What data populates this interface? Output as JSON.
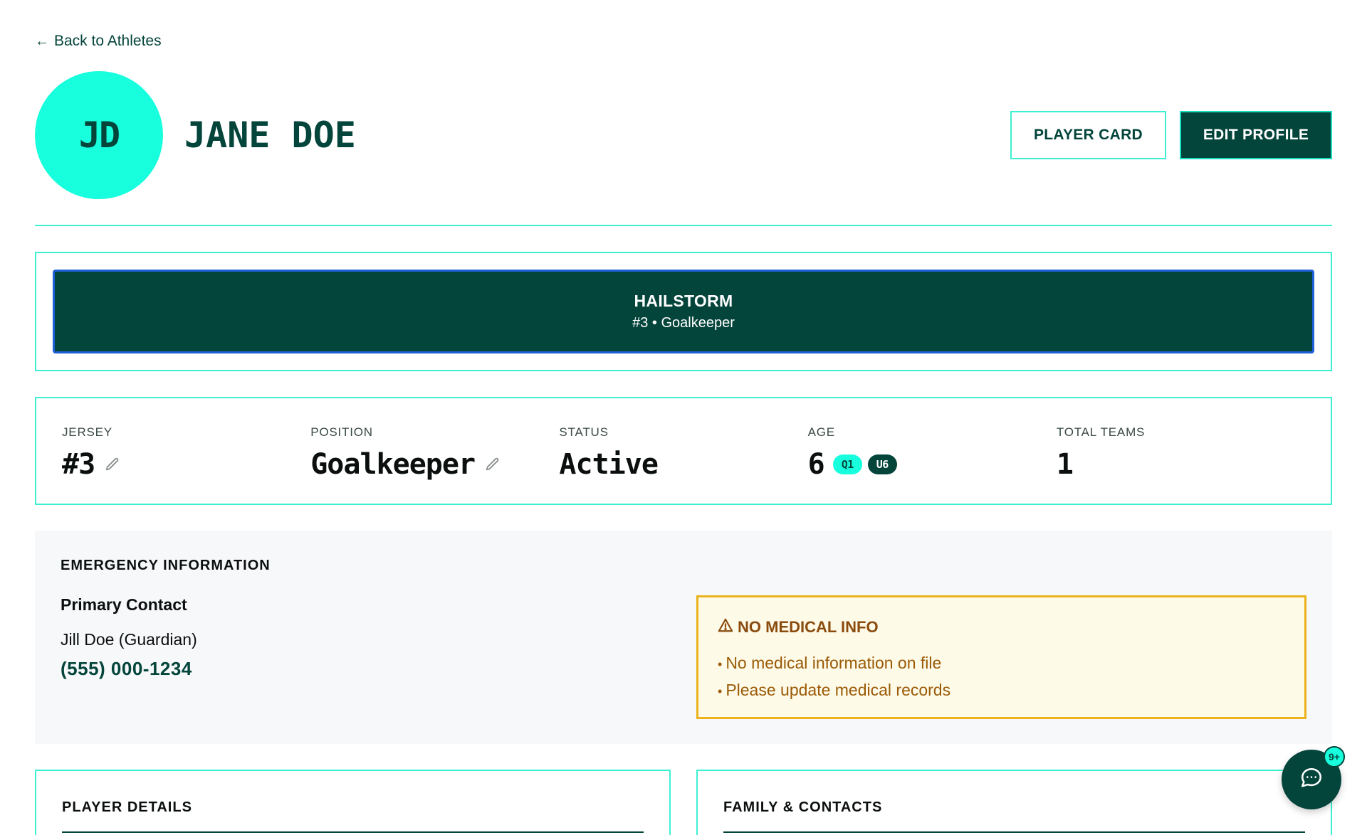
{
  "nav": {
    "back_label": "Back to Athletes",
    "back_icon": "arrow-left-icon"
  },
  "profile": {
    "initials": "JD",
    "name": "JANE DOE",
    "player_card_label": "PLAYER CARD",
    "edit_profile_label": "EDIT PROFILE"
  },
  "team": {
    "name": "HAILSTORM",
    "subtitle": "#3 • Goalkeeper"
  },
  "stats": {
    "jersey": {
      "label": "JERSEY",
      "value": "#3"
    },
    "position": {
      "label": "POSITION",
      "value": "Goalkeeper"
    },
    "status": {
      "label": "STATUS",
      "value": "Active"
    },
    "age": {
      "label": "AGE",
      "value": "6",
      "quarter_badge": "Q1",
      "group_badge": "U6"
    },
    "total_teams": {
      "label": "TOTAL TEAMS",
      "value": "1"
    }
  },
  "emergency": {
    "title": "EMERGENCY INFORMATION",
    "primary_title": "Primary Contact",
    "contact_name": "Jill Doe (Guardian)",
    "contact_phone": "(555) 000-1234",
    "medical": {
      "title": "NO MEDICAL INFO",
      "icon": "warning-icon",
      "items": [
        "No medical information on file",
        "Please update medical records"
      ]
    }
  },
  "sections": {
    "player_details": "PLAYER DETAILS",
    "family_contacts": "FAMILY & CONTACTS"
  },
  "chat": {
    "badge": "9+",
    "icon": "chat-icon"
  },
  "colors": {
    "brand_dark": "#03443b",
    "brand_accent": "#17ffdd",
    "border_accent": "#3ef0d3",
    "warning_bg": "#fefae8",
    "warning_border": "#ebb21b",
    "warning_text": "#9a5a06"
  }
}
